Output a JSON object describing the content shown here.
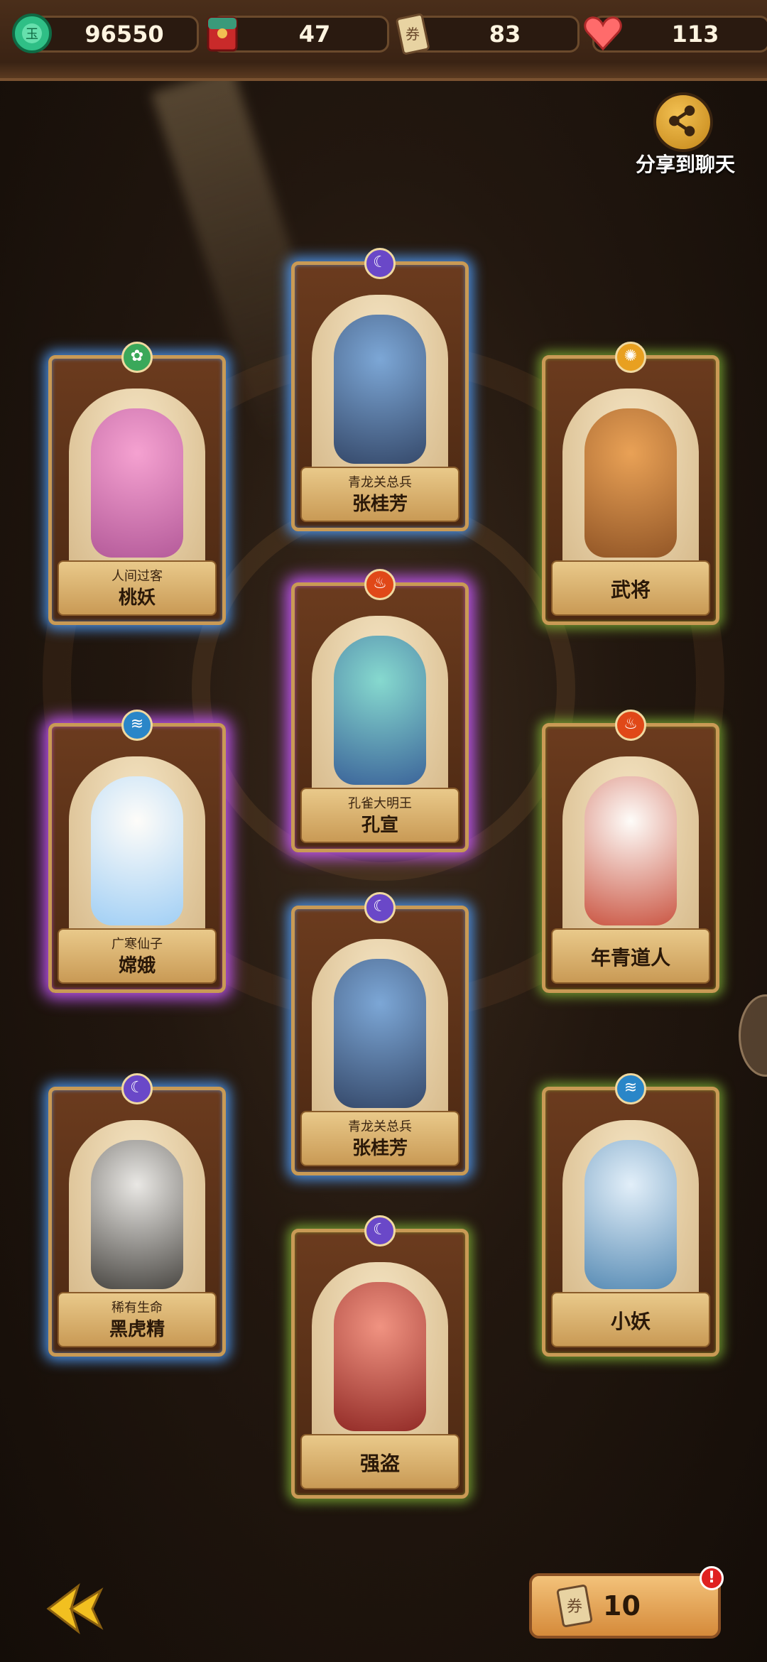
{
  "resources": [
    {
      "icon": "jade-coin-icon",
      "value": "96550"
    },
    {
      "icon": "red-envelope-icon",
      "value": "47"
    },
    {
      "icon": "ticket-icon",
      "value": "83"
    },
    {
      "icon": "heart-icon",
      "value": "113"
    }
  ],
  "share": {
    "label": "分享到聊天",
    "icon": "share-icon"
  },
  "cards": [
    {
      "subtitle": "人间过客",
      "name": "桃妖",
      "element": "wood",
      "frame": "blue"
    },
    {
      "subtitle": "青龙关总兵",
      "name": "张桂芳",
      "element": "moon",
      "frame": "blue"
    },
    {
      "subtitle": "",
      "name": "武将",
      "element": "sun",
      "frame": "green"
    },
    {
      "subtitle": "孔雀大明王",
      "name": "孔宣",
      "element": "fire",
      "frame": "purple"
    },
    {
      "subtitle": "广寒仙子",
      "name": "嫦娥",
      "element": "water",
      "frame": "purple"
    },
    {
      "subtitle": "",
      "name": "年青道人",
      "element": "fire",
      "frame": "green"
    },
    {
      "subtitle": "青龙关总兵",
      "name": "张桂芳",
      "element": "moon",
      "frame": "blue"
    },
    {
      "subtitle": "稀有生命",
      "name": "黑虎精",
      "element": "moon",
      "frame": "blue"
    },
    {
      "subtitle": "",
      "name": "小妖",
      "element": "water",
      "frame": "green"
    },
    {
      "subtitle": "",
      "name": "强盗",
      "element": "moon",
      "frame": "green"
    }
  ],
  "bottom": {
    "back_icon": "back-arrow-icon",
    "ticket_count": "10",
    "ticket_icon": "ticket-icon",
    "alert_mark": "!"
  },
  "colors": {
    "blue_frame": "#50a0ff",
    "purple_frame": "#c85aff",
    "green_frame": "#8cc83c",
    "wood": "#3aa85a",
    "moon": "#6a48c8",
    "sun": "#e8a020",
    "fire": "#e04818",
    "water": "#2a86c8"
  }
}
